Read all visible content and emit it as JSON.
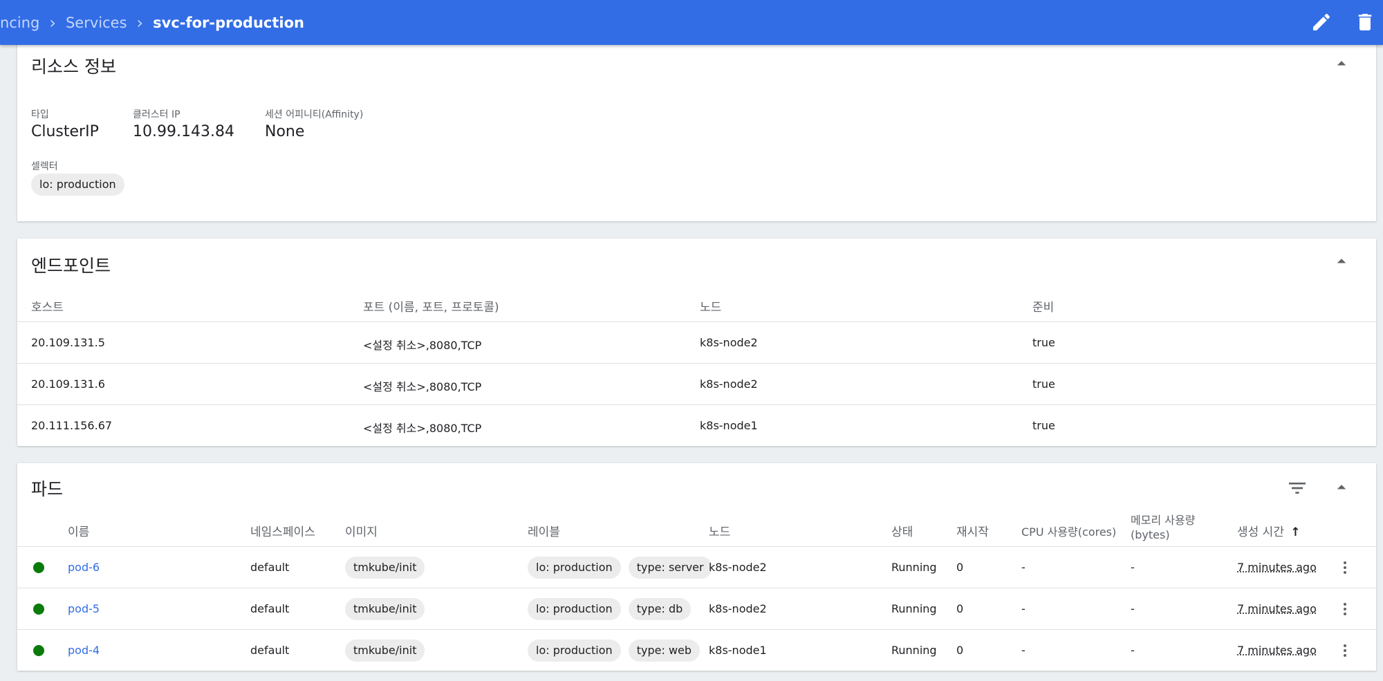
{
  "header": {
    "crumbs": [
      "ncing",
      "Services",
      "svc-for-production"
    ],
    "edit_icon": "pencil-icon",
    "delete_icon": "trash-icon"
  },
  "resource": {
    "title": "리소스 정보",
    "type_label": "타입",
    "type_value": "ClusterIP",
    "ip_label": "클러스터 IP",
    "ip_value": "10.99.143.84",
    "affinity_label": "세션 어피니티(Affinity)",
    "affinity_value": "None",
    "selector_label": "셀렉터",
    "selector_chip": "lo: production"
  },
  "endpoints": {
    "title": "엔드포인트",
    "headers": [
      "호스트",
      "포트 (이름, 포트, 프로토콜)",
      "노드",
      "준비"
    ],
    "rows": [
      {
        "host": "20.109.131.5",
        "ports": "<설정 취소>,8080,TCP",
        "node": "k8s-node2",
        "ready": "true"
      },
      {
        "host": "20.109.131.6",
        "ports": "<설정 취소>,8080,TCP",
        "node": "k8s-node2",
        "ready": "true"
      },
      {
        "host": "20.111.156.67",
        "ports": "<설정 취소>,8080,TCP",
        "node": "k8s-node1",
        "ready": "true"
      }
    ]
  },
  "pods": {
    "title": "파드",
    "headers": {
      "name": "이름",
      "namespace": "네임스페이스",
      "image": "이미지",
      "labels": "레이블",
      "node": "노드",
      "status": "상태",
      "restarts": "재시작",
      "cpu": "CPU 사용량(cores)",
      "memory": "메모리 사용량",
      "memory_unit": "(bytes)",
      "created": "생성 시간",
      "sort_icon": "↑"
    },
    "rows": [
      {
        "name": "pod-6",
        "namespace": "default",
        "image": "tmkube/init",
        "label1": "lo: production",
        "label2": "type: server",
        "node": "k8s-node2",
        "status": "Running",
        "restarts": "0",
        "cpu": "-",
        "memory": "-",
        "created": "7 minutes ago"
      },
      {
        "name": "pod-5",
        "namespace": "default",
        "image": "tmkube/init",
        "label1": "lo: production",
        "label2": "type: db",
        "node": "k8s-node2",
        "status": "Running",
        "restarts": "0",
        "cpu": "-",
        "memory": "-",
        "created": "7 minutes ago"
      },
      {
        "name": "pod-4",
        "namespace": "default",
        "image": "tmkube/init",
        "label1": "lo: production",
        "label2": "type: web",
        "node": "k8s-node1",
        "status": "Running",
        "restarts": "0",
        "cpu": "-",
        "memory": "-",
        "created": "7 minutes ago"
      }
    ],
    "status_color": "#0a7a0a"
  },
  "colors": {
    "header": "#326de6",
    "link": "#326de6",
    "background": "#eceff1"
  }
}
